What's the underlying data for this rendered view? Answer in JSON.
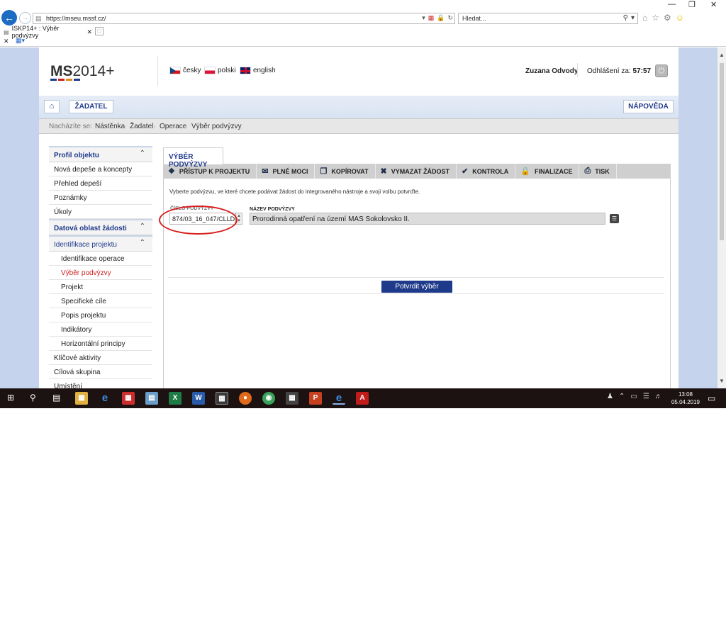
{
  "browser": {
    "url": "https://mseu.mssf.cz/",
    "search_placeholder": "Hledat...",
    "tab_title": "ISKP14+ : Výběr podvýzvy"
  },
  "header": {
    "logo_a": "MS",
    "logo_b": "2014+",
    "languages": [
      "česky",
      "polski",
      "english"
    ],
    "user": "Zuzana Odvody",
    "logout_label": "Odhlášení za:",
    "logout_time": "57:57"
  },
  "nav": {
    "zadatel": "ŽADATEL",
    "napoveda": "NÁPOVĚDA"
  },
  "breadcrumb": {
    "label": "Nacházíte se:",
    "items": [
      "Nástěnka",
      "Žadatel",
      "Operace",
      "Výběr podvýzvy"
    ]
  },
  "sidebar": {
    "section1": "Profil objektu",
    "items1": [
      "Nová depeše a koncepty",
      "Přehled depeší",
      "Poznámky",
      "Úkoly"
    ],
    "section2": "Datová oblast žádosti",
    "section3": "Identifikace projektu",
    "sub_items": [
      "Identifikace operace",
      "Výběr podvýzvy",
      "Projekt",
      "Specifické cíle",
      "Popis projektu",
      "Indikátory",
      "Horizontální principy"
    ],
    "items2": [
      "Klíčové aktivity",
      "Cílová skupina",
      "Umístění"
    ]
  },
  "main": {
    "tab": "VÝBĚR PODVÝZVY",
    "toolbar": [
      "PŘÍSTUP K PROJEKTU",
      "PLNÉ MOCI",
      "KOPÍROVAT",
      "VYMAZAT ŽÁDOST",
      "KONTROLA",
      "FINALIZACE",
      "TISK"
    ],
    "instruction": "Vyberte podvýzvu, ve které chcete podávat žádost do integrovaného nástroje a svoji volbu potvrďte.",
    "code_label": "ČÍSLO PODVÝZVY",
    "code_value": "874/03_16_047/CLLD_",
    "name_label": "NÁZEV PODVÝZVY",
    "name_value": "Prorodinná opatření na území MAS Sokolovsko II.",
    "confirm": "Potvrdit výběr"
  },
  "taskbar": {
    "time": "13:08",
    "date": "05.04.2019"
  }
}
